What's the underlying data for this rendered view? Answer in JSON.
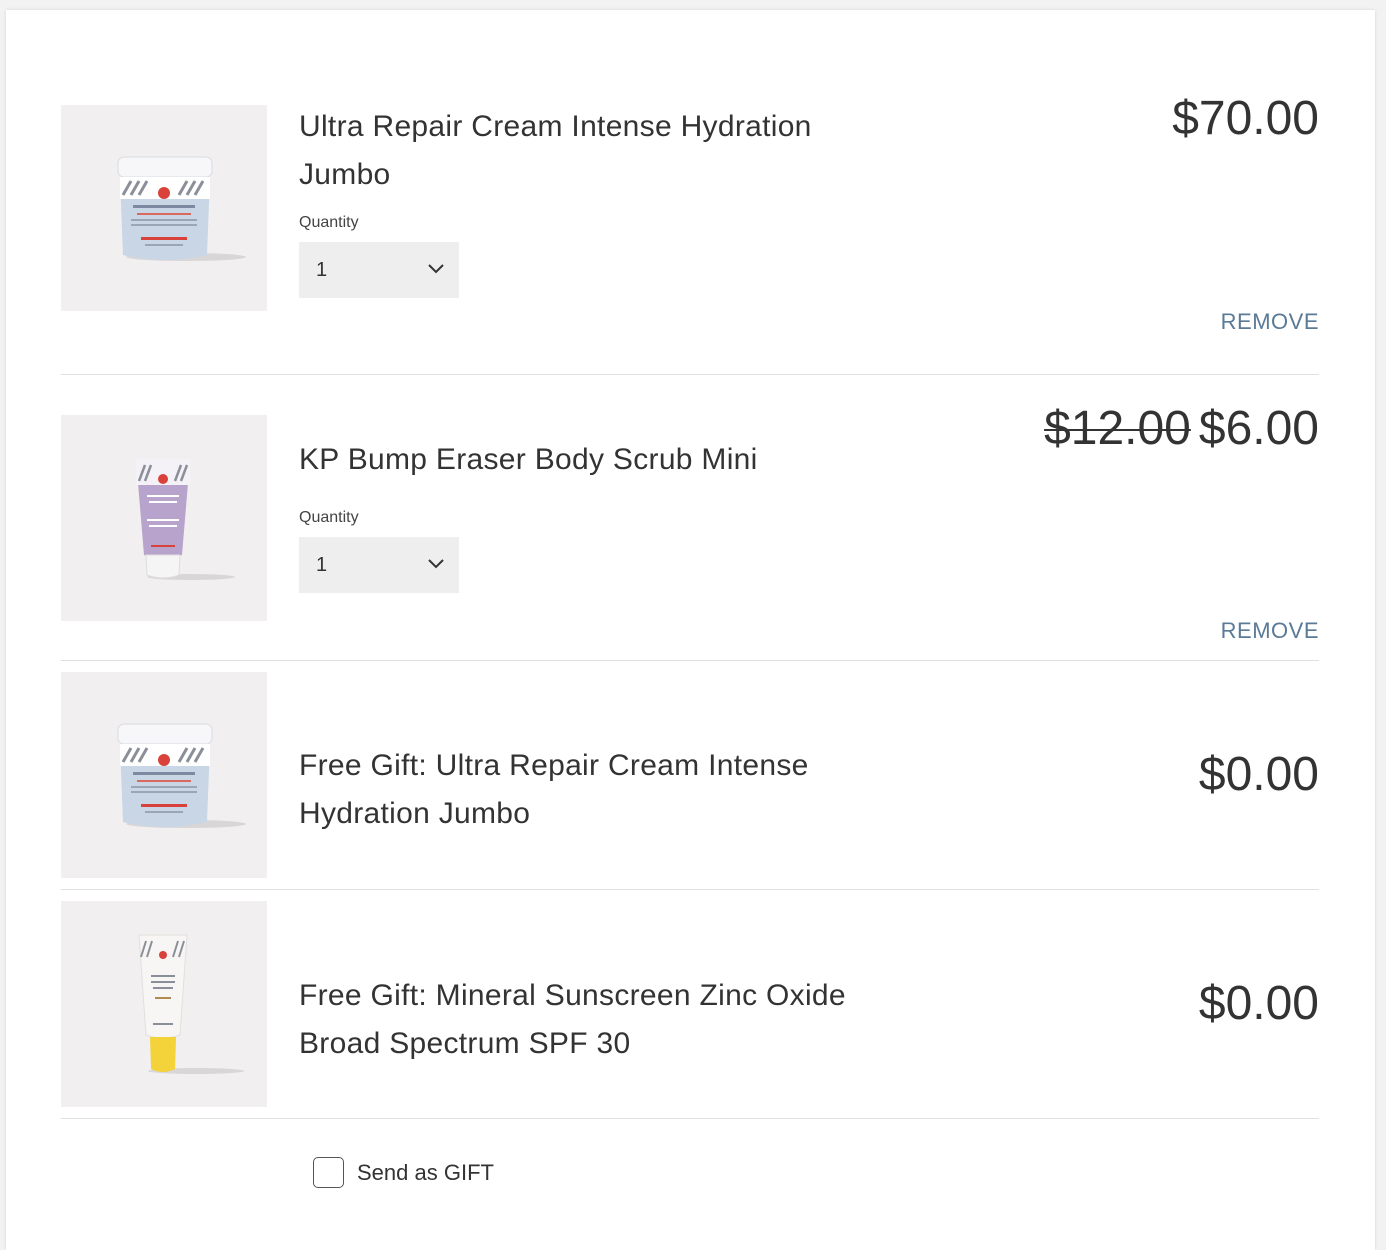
{
  "cart": {
    "items": [
      {
        "name": "Ultra Repair Cream Intense Hydration Jumbo",
        "quantity_label": "Quantity",
        "quantity": "1",
        "price": "$70.00",
        "remove_label": "REMOVE",
        "image_icon": "jar-product-image"
      },
      {
        "name": "KP Bump Eraser Body Scrub Mini",
        "quantity_label": "Quantity",
        "quantity": "1",
        "original_price": "$12.00",
        "price": "$6.00",
        "remove_label": "REMOVE",
        "image_icon": "tube-product-image"
      },
      {
        "name": "Free Gift: Ultra Repair Cream Intense Hydration Jumbo",
        "price": "$0.00",
        "image_icon": "jar-product-image"
      },
      {
        "name": "Free Gift: Mineral Sunscreen Zinc Oxide Broad Spectrum SPF 30",
        "price": "$0.00",
        "image_icon": "sunscreen-product-image"
      }
    ],
    "gift_option": {
      "label": "Send as GIFT",
      "checked": false
    }
  },
  "colors": {
    "remove_link": "#5a7a96",
    "thumb_background": "#f1eff0",
    "select_background": "#eeeeee"
  }
}
